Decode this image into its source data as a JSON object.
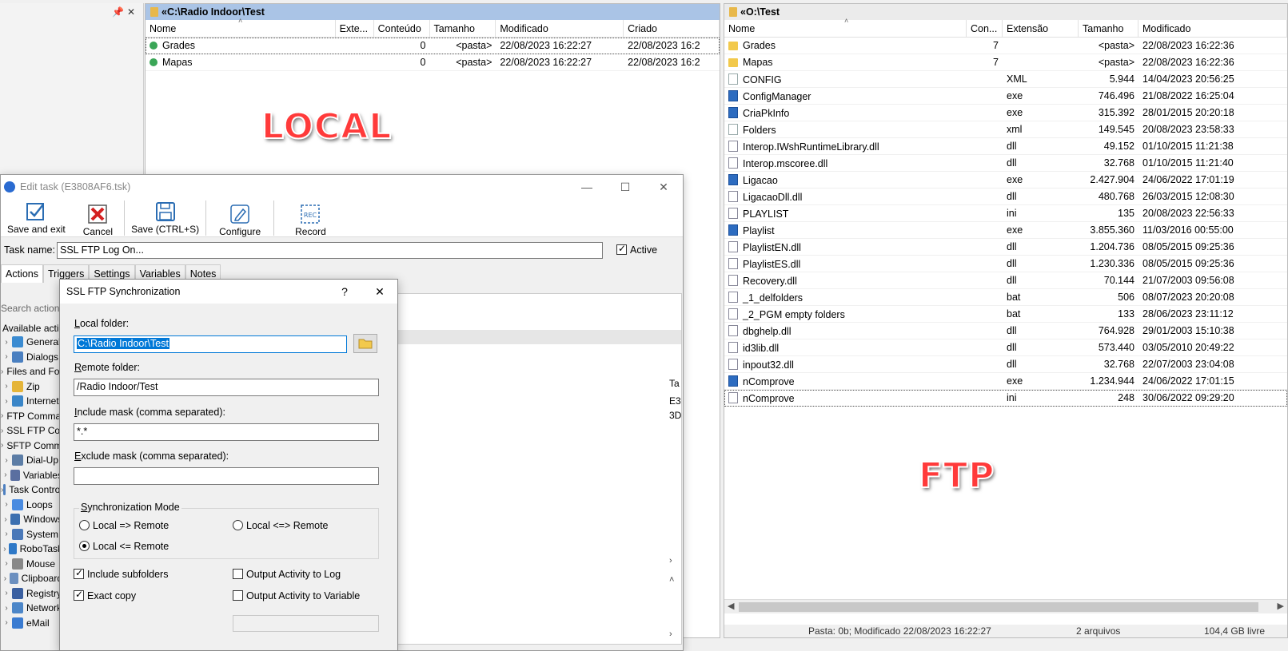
{
  "local": {
    "path": "«C:\\Radio Indoor\\Test",
    "columns": [
      "Nome",
      "Exte...",
      "Conteúdo",
      "Tamanho",
      "Modificado",
      "Criado"
    ],
    "rows": [
      {
        "name": "Grades",
        "ext": "",
        "content": "0",
        "size": "<pasta>",
        "modified": "22/08/2023 16:22:27",
        "created": "22/08/2023 16:2"
      },
      {
        "name": "Mapas",
        "ext": "",
        "content": "0",
        "size": "<pasta>",
        "modified": "22/08/2023 16:22:27",
        "created": "22/08/2023 16:2"
      }
    ],
    "overlay_label": "LOCAL"
  },
  "ftp": {
    "path": "«O:\\Test",
    "columns": [
      "Nome",
      "Con...",
      "Extensão",
      "Tamanho",
      "Modificado"
    ],
    "rows": [
      {
        "name": "Grades",
        "count": "7",
        "ext": "",
        "size": "<pasta>",
        "modified": "22/08/2023 16:22:36",
        "icon": "folder"
      },
      {
        "name": "Mapas",
        "count": "7",
        "ext": "",
        "size": "<pasta>",
        "modified": "22/08/2023 16:22:36",
        "icon": "folder"
      },
      {
        "name": "CONFIG",
        "count": "",
        "ext": "XML",
        "size": "5.944",
        "modified": "14/04/2023 20:56:25",
        "icon": "file"
      },
      {
        "name": "ConfigManager",
        "count": "",
        "ext": "exe",
        "size": "746.496",
        "modified": "21/08/2022 16:25:04",
        "icon": "exe"
      },
      {
        "name": "CriaPkInfo",
        "count": "",
        "ext": "exe",
        "size": "315.392",
        "modified": "28/01/2015 20:20:18",
        "icon": "exe"
      },
      {
        "name": "Folders",
        "count": "",
        "ext": "xml",
        "size": "149.545",
        "modified": "20/08/2023 23:58:33",
        "icon": "file"
      },
      {
        "name": "Interop.IWshRuntimeLibrary.dll",
        "count": "",
        "ext": "dll",
        "size": "49.152",
        "modified": "01/10/2015 11:21:38",
        "icon": "dll"
      },
      {
        "name": "Interop.mscoree.dll",
        "count": "",
        "ext": "dll",
        "size": "32.768",
        "modified": "01/10/2015 11:21:40",
        "icon": "dll"
      },
      {
        "name": "Ligacao",
        "count": "",
        "ext": "exe",
        "size": "2.427.904",
        "modified": "24/06/2022 17:01:19",
        "icon": "exe"
      },
      {
        "name": "LigacaoDll.dll",
        "count": "",
        "ext": "dll",
        "size": "480.768",
        "modified": "26/03/2015 12:08:30",
        "icon": "dll"
      },
      {
        "name": "PLAYLIST",
        "count": "",
        "ext": "ini",
        "size": "135",
        "modified": "20/08/2023 22:56:33",
        "icon": "dll"
      },
      {
        "name": "Playlist",
        "count": "",
        "ext": "exe",
        "size": "3.855.360",
        "modified": "11/03/2016 00:55:00",
        "icon": "exe"
      },
      {
        "name": "PlaylistEN.dll",
        "count": "",
        "ext": "dll",
        "size": "1.204.736",
        "modified": "08/05/2015 09:25:36",
        "icon": "dll"
      },
      {
        "name": "PlaylistES.dll",
        "count": "",
        "ext": "dll",
        "size": "1.230.336",
        "modified": "08/05/2015 09:25:36",
        "icon": "dll"
      },
      {
        "name": "Recovery.dll",
        "count": "",
        "ext": "dll",
        "size": "70.144",
        "modified": "21/07/2003 09:56:08",
        "icon": "dll"
      },
      {
        "name": "_1_delfolders",
        "count": "",
        "ext": "bat",
        "size": "506",
        "modified": "08/07/2023 20:20:08",
        "icon": "bat"
      },
      {
        "name": "_2_PGM empty folders",
        "count": "",
        "ext": "bat",
        "size": "133",
        "modified": "28/06/2023 23:11:12",
        "icon": "bat"
      },
      {
        "name": "dbghelp.dll",
        "count": "",
        "ext": "dll",
        "size": "764.928",
        "modified": "29/01/2003 15:10:38",
        "icon": "dll"
      },
      {
        "name": "id3lib.dll",
        "count": "",
        "ext": "dll",
        "size": "573.440",
        "modified": "03/05/2010 20:49:22",
        "icon": "dll"
      },
      {
        "name": "inpout32.dll",
        "count": "",
        "ext": "dll",
        "size": "32.768",
        "modified": "22/07/2003 23:04:08",
        "icon": "dll"
      },
      {
        "name": "nComprove",
        "count": "",
        "ext": "exe",
        "size": "1.234.944",
        "modified": "24/06/2022 17:01:15",
        "icon": "exe"
      },
      {
        "name": "nComprove",
        "count": "",
        "ext": "ini",
        "size": "248",
        "modified": "30/06/2022 09:29:20",
        "icon": "dll"
      }
    ],
    "overlay_label": "FTP",
    "status": {
      "left": "Pasta: 0b; Modificado 22/08/2023 16:22:27",
      "count": "2 arquivos",
      "free": "104,4 GB livre"
    }
  },
  "edit_task": {
    "title": "Edit task (E3808AF6.tsk)",
    "toolbar": {
      "save_exit": "Save and exit",
      "cancel": "Cancel",
      "save": "Save (CTRL+S)",
      "configure": "Configure",
      "record": "Record"
    },
    "task_name_label": "Task name:",
    "task_name_value": "SSL FTP Log On...",
    "active_label": "Active",
    "tabs": [
      "Actions",
      "Triggers",
      "Settings",
      "Variables",
      "Notes"
    ],
    "search_placeholder": "Search actions",
    "available_label": "Available actions",
    "tree": [
      "General",
      "Dialogs",
      "Files and Folders",
      "Zip",
      "Internet",
      "FTP Commands",
      "SSL FTP Commands",
      "SFTP Commands",
      "Dial-Up",
      "Variables",
      "Task Control",
      "Loops",
      "Windows",
      "System",
      "RoboTask",
      "Mouse",
      "Clipboard",
      "Registry",
      "Network",
      "eMail"
    ],
    "right_cells": [
      "Ta",
      "E3",
      "3D"
    ]
  },
  "sync_dialog": {
    "title": "SSL FTP Synchronization",
    "help": "?",
    "close": "✕",
    "local_folder_label": "Local folder:",
    "local_folder_value": "C:\\Radio Indoor\\Test",
    "remote_folder_label": "Remote folder:",
    "remote_folder_value": "/Radio Indoor/Test",
    "include_mask_label": "Include mask (comma separated):",
    "include_mask_value": "*.*",
    "exclude_mask_label": "Exclude mask (comma separated):",
    "exclude_mask_value": "",
    "sync_mode_label": "Synchronization Mode",
    "mode_local_to_remote": "Local => Remote",
    "mode_both": "Local <=> Remote",
    "mode_remote_to_local": "Local <= Remote",
    "include_subfolders": "Include subfolders",
    "exact_copy": "Exact copy",
    "output_log": "Output Activity to Log",
    "output_variable": "Output Activity to Variable"
  }
}
